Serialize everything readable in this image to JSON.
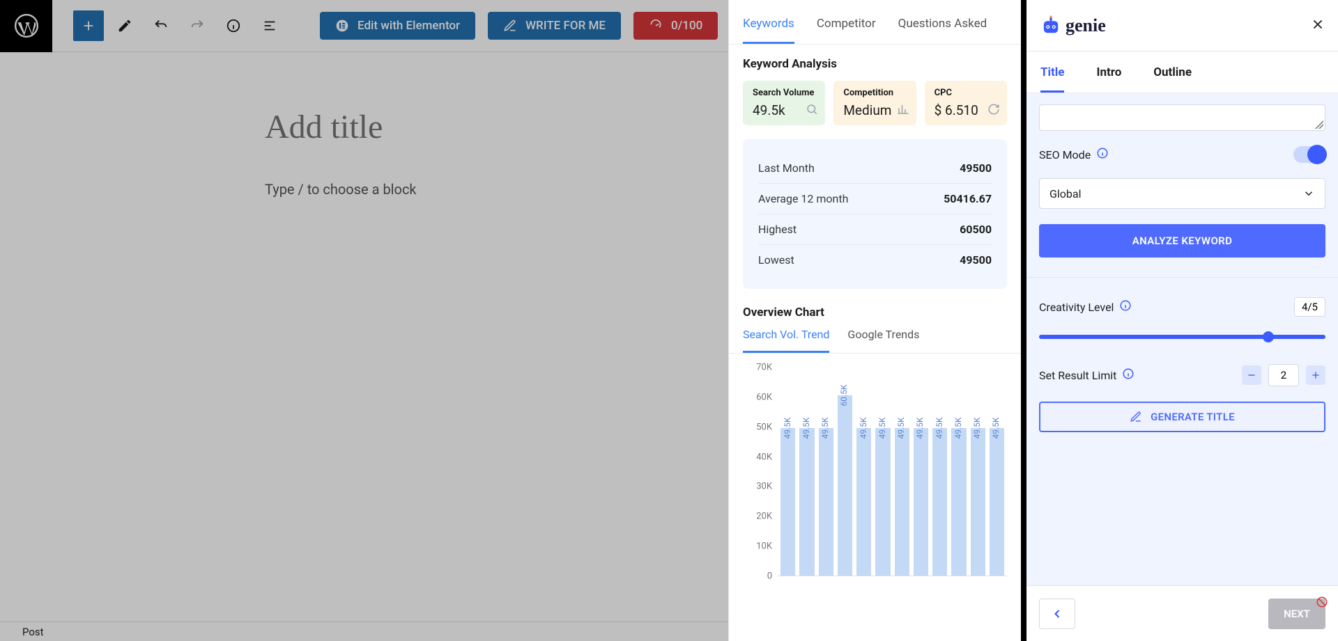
{
  "wp": {
    "title_placeholder": "Add title",
    "body_placeholder": "Type / to choose a block",
    "footer_label": "Post",
    "elementor": "Edit with Elementor",
    "write_for_me": "WRITE FOR ME",
    "score": "0/100"
  },
  "logo_text": "genie",
  "kw_tabs": [
    "Keywords",
    "Competitor",
    "Questions Asked"
  ],
  "kw_heading": "Keyword Analysis",
  "stats": {
    "sv_label": "Search Volume",
    "sv_value": "49.5k",
    "comp_label": "Competition",
    "comp_value": "Medium",
    "cpc_label": "CPC",
    "cpc_value": "$ 6.510"
  },
  "metrics": [
    {
      "label": "Last Month",
      "value": "49500"
    },
    {
      "label": "Average 12 month",
      "value": "50416.67"
    },
    {
      "label": "Highest",
      "value": "60500"
    },
    {
      "label": "Lowest",
      "value": "49500"
    }
  ],
  "overview_heading": "Overview Chart",
  "overview_tabs": [
    "Search Vol. Trend",
    "Google Trends"
  ],
  "chart_data": {
    "type": "bar",
    "categories": [
      "",
      "",
      "",
      "",
      "",
      "",
      "",
      "",
      "",
      "",
      "",
      ""
    ],
    "values": [
      49500,
      49500,
      49500,
      60500,
      49500,
      49500,
      49500,
      49500,
      49500,
      49500,
      49500,
      49500
    ],
    "bar_labels": [
      "49.5K",
      "49.5K",
      "49.5K",
      "60.5K",
      "49.5K",
      "49.5K",
      "49.5K",
      "49.5K",
      "49.5K",
      "49.5K",
      "49.5K",
      "49.5K"
    ],
    "ylabel": "",
    "ylim": [
      0,
      70000
    ],
    "yticks": [
      0,
      10000,
      20000,
      30000,
      40000,
      50000,
      60000,
      70000
    ],
    "ytick_labels": [
      "0",
      "10K",
      "20K",
      "30K",
      "40K",
      "50K",
      "60K",
      "70K"
    ]
  },
  "gen_tabs": [
    "Title",
    "Intro",
    "Outline"
  ],
  "gen": {
    "seo_label": "SEO Mode",
    "country": "Global",
    "analyze": "ANALYZE KEYWORD",
    "creativity_label": "Creativity Level",
    "creativity_value": "4/5",
    "limit_label": "Set Result Limit",
    "limit_value": "2",
    "generate": "GENERATE TITLE",
    "next": "NEXT"
  }
}
